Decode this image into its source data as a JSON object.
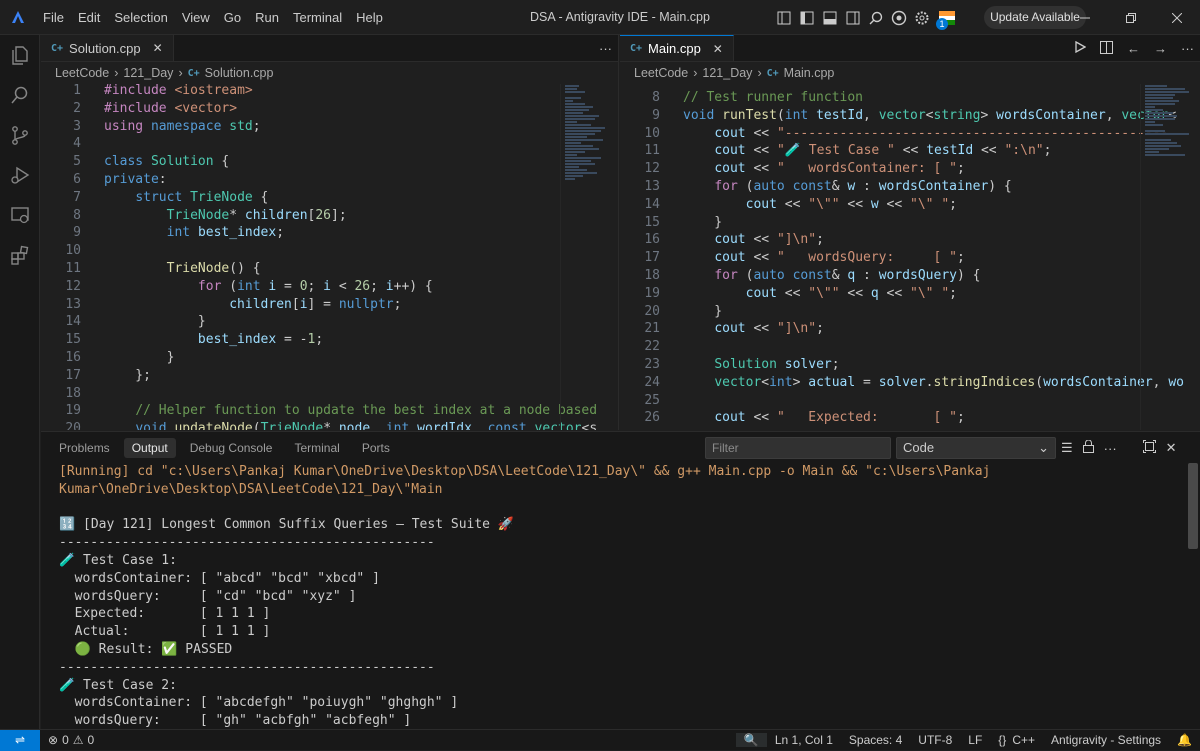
{
  "menu": [
    "File",
    "Edit",
    "Selection",
    "View",
    "Go",
    "Run",
    "Terminal",
    "Help"
  ],
  "window_title": "DSA - Antigravity IDE - Main.cpp",
  "update_button": "Update Available",
  "badge_count": "1",
  "left_editor": {
    "tab": "Solution.cpp",
    "breadcrumb": [
      "LeetCode",
      "121_Day",
      "Solution.cpp"
    ],
    "line_numbers": [
      "1",
      "2",
      "3",
      "4",
      "5",
      "6",
      "7",
      "8",
      "9",
      "10",
      "11",
      "12",
      "13",
      "14",
      "15",
      "16",
      "17",
      "18",
      "19",
      "20"
    ]
  },
  "right_editor": {
    "tab": "Main.cpp",
    "breadcrumb": [
      "LeetCode",
      "121_Day",
      "Main.cpp"
    ],
    "line_numbers": [
      "8",
      "9",
      "10",
      "11",
      "12",
      "13",
      "14",
      "15",
      "16",
      "17",
      "18",
      "19",
      "20",
      "21",
      "22",
      "23",
      "24",
      "25",
      "26"
    ]
  },
  "panel": {
    "tabs": [
      "Problems",
      "Output",
      "Debug Console",
      "Terminal",
      "Ports"
    ],
    "filter_placeholder": "Filter",
    "channel": "Code",
    "output_lines": [
      "[Running] cd \"c:\\Users\\Pankaj Kumar\\OneDrive\\Desktop\\DSA\\LeetCode\\121_Day\\\" && g++ Main.cpp -o Main && \"c:\\Users\\Pankaj",
      "Kumar\\OneDrive\\Desktop\\DSA\\LeetCode\\121_Day\\\"Main",
      "",
      "🔢 [Day 121] Longest Common Suffix Queries – Test Suite 🚀",
      "------------------------------------------------",
      "🧪 Test Case 1:",
      "  wordsContainer: [ \"abcd\" \"bcd\" \"xbcd\" ]",
      "  wordsQuery:     [ \"cd\" \"bcd\" \"xyz\" ]",
      "  Expected:       [ 1 1 1 ]",
      "  Actual:         [ 1 1 1 ]",
      "  🟢 Result: ✅ PASSED",
      "------------------------------------------------",
      "🧪 Test Case 2:",
      "  wordsContainer: [ \"abcdefgh\" \"poiuygh\" \"ghghgh\" ]",
      "  wordsQuery:     [ \"gh\" \"acbfgh\" \"acbfegh\" ]"
    ]
  },
  "status": {
    "errors": "0",
    "warnings": "0",
    "position": "Ln 1, Col 1",
    "spaces": "Spaces: 4",
    "encoding": "UTF-8",
    "eol": "LF",
    "language": "C++",
    "settings": "Antigravity - Settings"
  }
}
